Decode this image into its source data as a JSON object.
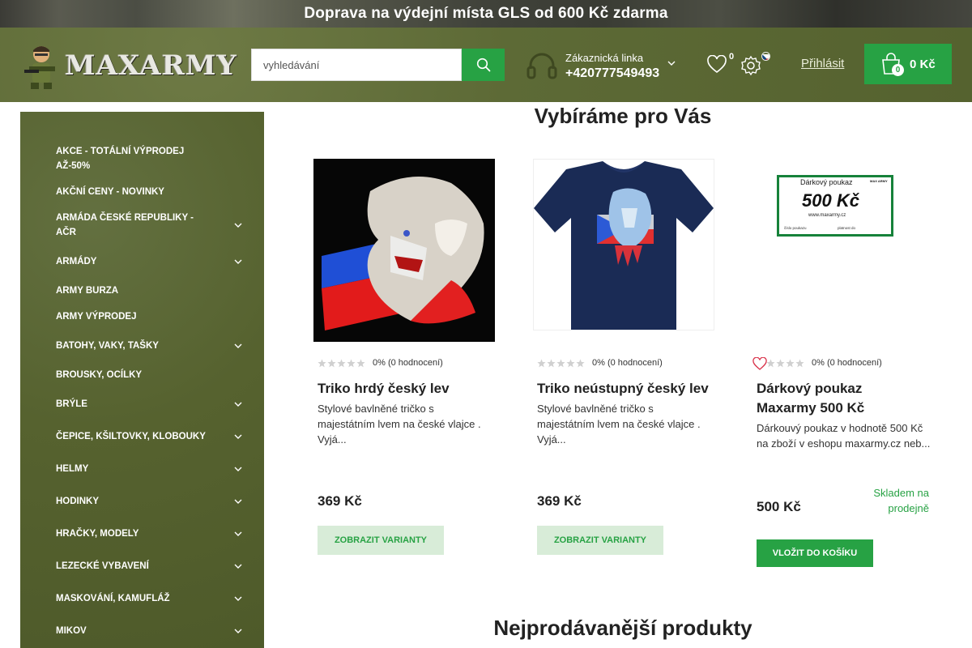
{
  "banner": {
    "text": "Doprava na výdejní místa GLS od 600 Kč zdarma"
  },
  "header": {
    "logo_text": "MAXARMY",
    "search_placeholder": "vyhledávání",
    "support_label": "Zákaznická linka",
    "support_phone": "+420777549493",
    "wishlist_count": "0",
    "login_label": "Přihlásit",
    "cart_count": "0",
    "cart_total": "0 Kč"
  },
  "sidebar": {
    "items": [
      {
        "label": "AKCE - TOTÁLNÍ VÝPRODEJ AŽ-50%",
        "has_children": false
      },
      {
        "label": "AKČNÍ CENY - NOVINKY",
        "has_children": false
      },
      {
        "label": "ARMÁDA ČESKÉ REPUBLIKY - AČR",
        "has_children": true
      },
      {
        "label": "ARMÁDY",
        "has_children": true
      },
      {
        "label": "ARMY BURZA",
        "has_children": false
      },
      {
        "label": "ARMY VÝPRODEJ",
        "has_children": false
      },
      {
        "label": "BATOHY, VAKY, TAŠKY",
        "has_children": true
      },
      {
        "label": "BROUSKY, OCÍLKY",
        "has_children": false
      },
      {
        "label": "BRÝLE",
        "has_children": true
      },
      {
        "label": "ČEPICE, KŠILTOVKY, KLOBOUKY",
        "has_children": true
      },
      {
        "label": "HELMY",
        "has_children": true
      },
      {
        "label": "HODINKY",
        "has_children": true
      },
      {
        "label": "HRAČKY, MODELY",
        "has_children": true
      },
      {
        "label": "LEZECKÉ VYBAVENÍ",
        "has_children": true
      },
      {
        "label": "MASKOVÁNÍ, KAMUFLÁŽ",
        "has_children": true
      },
      {
        "label": "MIKOV",
        "has_children": true
      }
    ]
  },
  "main": {
    "section_title": "Vybíráme pro Vás",
    "section2_title": "Nejprodávanější produkty",
    "products": [
      {
        "rating_text": "0% (0 hodnocení)",
        "title": "Triko hrdý český lev",
        "desc": "Stylové bavlněné tričko s majestátním lvem na české vlajce . Vyjá...",
        "price": "369 Kč",
        "button": "ZOBRAZIT VARIANTY"
      },
      {
        "rating_text": "0% (0 hodnocení)",
        "title": "Triko neústupný český lev",
        "desc": "Stylové bavlněné tričko s majestátním lvem na české vlajce . Vyjá...",
        "price": "369 Kč",
        "button": "ZOBRAZIT VARIANTY"
      },
      {
        "rating_text": "0% (0 hodnocení)",
        "title": "Dárkový poukaz Maxarmy 500 Kč",
        "desc": "Dárkouvý poukaz v hodnotě 500 Kč na zboží v eshopu maxarmy.cz neb...",
        "price": "500 Kč",
        "stock": "Skladem na prodejně",
        "button": "VLOŽIT DO KOŠÍKU",
        "voucher": {
          "heading": "Dárkový poukaz",
          "amount": "500 Kč",
          "site": "www.maxarmy.cz",
          "line1": "číslo poukazu",
          "line2": "platnost do",
          "brand": "MAX ARMY"
        }
      }
    ]
  },
  "colors": {
    "accent_green": "#27a244",
    "army_green": "#56622f",
    "rating_star": "#d0d0d0"
  }
}
